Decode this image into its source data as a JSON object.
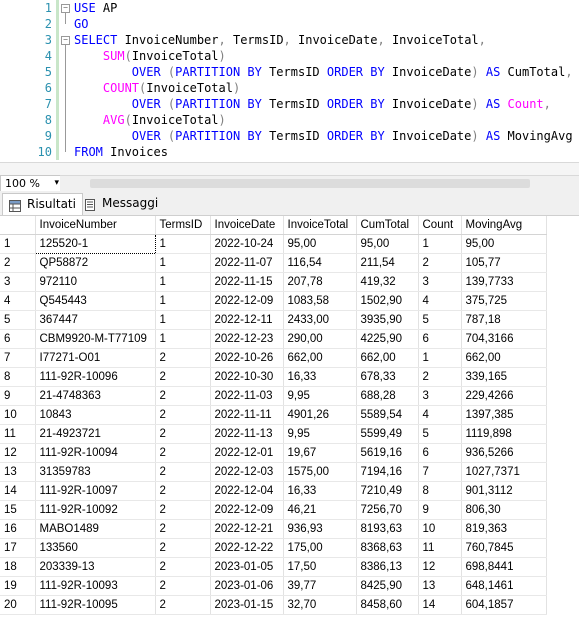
{
  "editor": {
    "lines": [
      {
        "num": "1",
        "tokens": [
          {
            "t": "USE",
            "c": "kw"
          },
          {
            "t": " AP",
            "c": ""
          }
        ]
      },
      {
        "num": "2",
        "tokens": [
          {
            "t": "GO",
            "c": "kw"
          }
        ]
      },
      {
        "num": "3",
        "tokens": [
          {
            "t": "SELECT",
            "c": "kw"
          },
          {
            "t": " InvoiceNumber",
            "c": ""
          },
          {
            "t": ",",
            "c": "gray"
          },
          {
            "t": " TermsID",
            "c": ""
          },
          {
            "t": ",",
            "c": "gray"
          },
          {
            "t": " InvoiceDate",
            "c": ""
          },
          {
            "t": ",",
            "c": "gray"
          },
          {
            "t": " InvoiceTotal",
            "c": ""
          },
          {
            "t": ",",
            "c": "gray"
          }
        ]
      },
      {
        "num": "4",
        "tokens": [
          {
            "t": "    ",
            "c": ""
          },
          {
            "t": "SUM",
            "c": "fn"
          },
          {
            "t": "(",
            "c": "gray"
          },
          {
            "t": "InvoiceTotal",
            "c": ""
          },
          {
            "t": ")",
            "c": "gray"
          }
        ]
      },
      {
        "num": "5",
        "tokens": [
          {
            "t": "        ",
            "c": ""
          },
          {
            "t": "OVER",
            "c": "kw"
          },
          {
            "t": " (",
            "c": "gray"
          },
          {
            "t": "PARTITION BY",
            "c": "kw"
          },
          {
            "t": " TermsID ",
            "c": ""
          },
          {
            "t": "ORDER BY",
            "c": "kw"
          },
          {
            "t": " InvoiceDate",
            "c": ""
          },
          {
            "t": ")",
            "c": "gray"
          },
          {
            "t": " AS",
            "c": "kw"
          },
          {
            "t": " CumTotal",
            "c": ""
          },
          {
            "t": ",",
            "c": "gray"
          }
        ]
      },
      {
        "num": "6",
        "tokens": [
          {
            "t": "    ",
            "c": ""
          },
          {
            "t": "COUNT",
            "c": "fn"
          },
          {
            "t": "(",
            "c": "gray"
          },
          {
            "t": "InvoiceTotal",
            "c": ""
          },
          {
            "t": ")",
            "c": "gray"
          }
        ]
      },
      {
        "num": "7",
        "tokens": [
          {
            "t": "        ",
            "c": ""
          },
          {
            "t": "OVER",
            "c": "kw"
          },
          {
            "t": " (",
            "c": "gray"
          },
          {
            "t": "PARTITION BY",
            "c": "kw"
          },
          {
            "t": " TermsID ",
            "c": ""
          },
          {
            "t": "ORDER BY",
            "c": "kw"
          },
          {
            "t": " InvoiceDate",
            "c": ""
          },
          {
            "t": ")",
            "c": "gray"
          },
          {
            "t": " AS",
            "c": "kw"
          },
          {
            "t": " Count",
            "c": "fn"
          },
          {
            "t": ",",
            "c": "gray"
          }
        ]
      },
      {
        "num": "8",
        "tokens": [
          {
            "t": "    ",
            "c": ""
          },
          {
            "t": "AVG",
            "c": "fn"
          },
          {
            "t": "(",
            "c": "gray"
          },
          {
            "t": "InvoiceTotal",
            "c": ""
          },
          {
            "t": ")",
            "c": "gray"
          }
        ]
      },
      {
        "num": "9",
        "tokens": [
          {
            "t": "        ",
            "c": ""
          },
          {
            "t": "OVER",
            "c": "kw"
          },
          {
            "t": " (",
            "c": "gray"
          },
          {
            "t": "PARTITION BY",
            "c": "kw"
          },
          {
            "t": " TermsID ",
            "c": ""
          },
          {
            "t": "ORDER BY",
            "c": "kw"
          },
          {
            "t": " InvoiceDate",
            "c": ""
          },
          {
            "t": ")",
            "c": "gray"
          },
          {
            "t": " AS",
            "c": "kw"
          },
          {
            "t": " MovingAvg",
            "c": ""
          }
        ]
      },
      {
        "num": "10",
        "tokens": [
          {
            "t": "FROM",
            "c": "kw"
          },
          {
            "t": " Invoices",
            "c": ""
          }
        ]
      }
    ]
  },
  "zoom": {
    "value": "100 %"
  },
  "tabs": {
    "results": "Risultati",
    "messages": "Messaggi"
  },
  "grid": {
    "columns": [
      "InvoiceNumber",
      "TermsID",
      "InvoiceDate",
      "InvoiceTotal",
      "CumTotal",
      "Count",
      "MovingAvg"
    ],
    "rows": [
      [
        "1",
        "125520-1",
        "1",
        "2022-10-24",
        "95,00",
        "95,00",
        "1",
        "95,00"
      ],
      [
        "2",
        "QP58872",
        "1",
        "2022-11-07",
        "116,54",
        "211,54",
        "2",
        "105,77"
      ],
      [
        "3",
        "972110",
        "1",
        "2022-11-15",
        "207,78",
        "419,32",
        "3",
        "139,7733"
      ],
      [
        "4",
        "Q545443",
        "1",
        "2022-12-09",
        "1083,58",
        "1502,90",
        "4",
        "375,725"
      ],
      [
        "5",
        "367447",
        "1",
        "2022-12-11",
        "2433,00",
        "3935,90",
        "5",
        "787,18"
      ],
      [
        "6",
        "CBM9920-M-T77109",
        "1",
        "2022-12-23",
        "290,00",
        "4225,90",
        "6",
        "704,3166"
      ],
      [
        "7",
        "I77271-O01",
        "2",
        "2022-10-26",
        "662,00",
        "662,00",
        "1",
        "662,00"
      ],
      [
        "8",
        "111-92R-10096",
        "2",
        "2022-10-30",
        "16,33",
        "678,33",
        "2",
        "339,165"
      ],
      [
        "9",
        "21-4748363",
        "2",
        "2022-11-03",
        "9,95",
        "688,28",
        "3",
        "229,4266"
      ],
      [
        "10",
        "10843",
        "2",
        "2022-11-11",
        "4901,26",
        "5589,54",
        "4",
        "1397,385"
      ],
      [
        "11",
        "21-4923721",
        "2",
        "2022-11-13",
        "9,95",
        "5599,49",
        "5",
        "1119,898"
      ],
      [
        "12",
        "111-92R-10094",
        "2",
        "2022-12-01",
        "19,67",
        "5619,16",
        "6",
        "936,5266"
      ],
      [
        "13",
        "31359783",
        "2",
        "2022-12-03",
        "1575,00",
        "7194,16",
        "7",
        "1027,7371"
      ],
      [
        "14",
        "111-92R-10097",
        "2",
        "2022-12-04",
        "16,33",
        "7210,49",
        "8",
        "901,3112"
      ],
      [
        "15",
        "111-92R-10092",
        "2",
        "2022-12-09",
        "46,21",
        "7256,70",
        "9",
        "806,30"
      ],
      [
        "16",
        "MABO1489",
        "2",
        "2022-12-21",
        "936,93",
        "8193,63",
        "10",
        "819,363"
      ],
      [
        "17",
        "133560",
        "2",
        "2022-12-22",
        "175,00",
        "8368,63",
        "11",
        "760,7845"
      ],
      [
        "18",
        "203339-13",
        "2",
        "2023-01-05",
        "17,50",
        "8386,13",
        "12",
        "698,8441"
      ],
      [
        "19",
        "111-92R-10093",
        "2",
        "2023-01-06",
        "39,77",
        "8425,90",
        "13",
        "648,1461"
      ],
      [
        "20",
        "111-92R-10095",
        "2",
        "2023-01-15",
        "32,70",
        "8458,60",
        "14",
        "604,1857"
      ]
    ]
  }
}
